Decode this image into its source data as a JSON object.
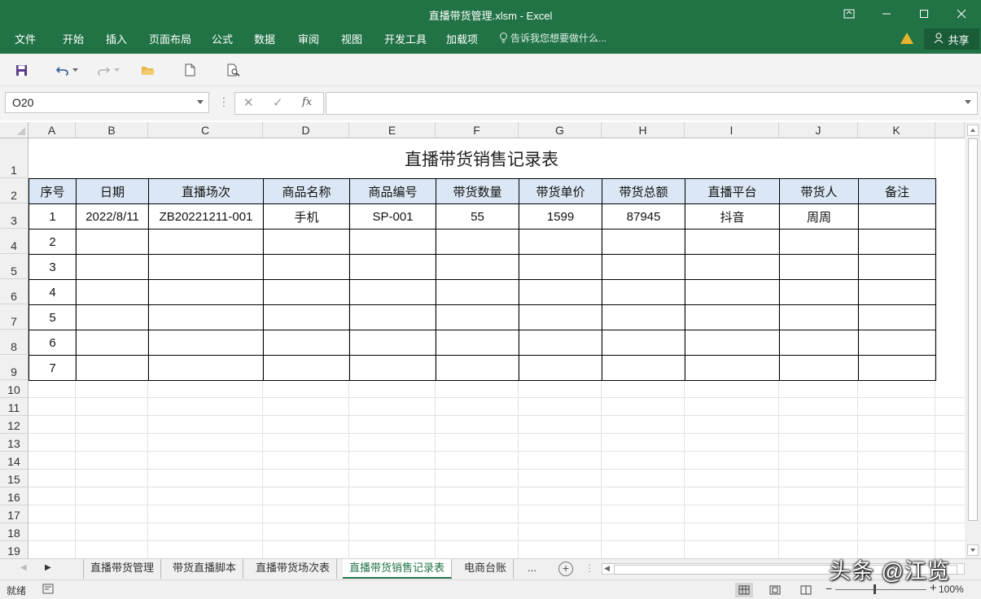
{
  "window": {
    "title": "直播带货管理.xlsm - Excel",
    "ribbon_tabs": [
      "文件",
      "开始",
      "插入",
      "页面布局",
      "公式",
      "数据",
      "审阅",
      "视图",
      "开发工具",
      "加载项"
    ],
    "tell_me": "告诉我您想要做什么...",
    "share": "共享"
  },
  "formula_bar": {
    "name_box": "O20",
    "fx": "fx",
    "content": ""
  },
  "grid": {
    "columns": [
      "A",
      "B",
      "C",
      "D",
      "E",
      "F",
      "G",
      "H",
      "I",
      "J",
      "K"
    ],
    "rows": [
      "1",
      "2",
      "3",
      "4",
      "5",
      "6",
      "7",
      "8",
      "9",
      "10",
      "11",
      "12",
      "13",
      "14",
      "15",
      "16",
      "17",
      "18",
      "19"
    ]
  },
  "sheet": {
    "title": "直播带货销售记录表",
    "headers": [
      "序号",
      "日期",
      "直播场次",
      "商品名称",
      "商品编号",
      "带货数量",
      "带货单价",
      "带货总额",
      "直播平台",
      "带货人",
      "备注"
    ],
    "rows": [
      [
        "1",
        "2022/8/11",
        "ZB20221211-001",
        "手机",
        "SP-001",
        "55",
        "1599",
        "87945",
        "抖音",
        "周周",
        ""
      ],
      [
        "2",
        "",
        "",
        "",
        "",
        "",
        "",
        "",
        "",
        "",
        ""
      ],
      [
        "3",
        "",
        "",
        "",
        "",
        "",
        "",
        "",
        "",
        "",
        ""
      ],
      [
        "4",
        "",
        "",
        "",
        "",
        "",
        "",
        "",
        "",
        "",
        ""
      ],
      [
        "5",
        "",
        "",
        "",
        "",
        "",
        "",
        "",
        "",
        "",
        ""
      ],
      [
        "6",
        "",
        "",
        "",
        "",
        "",
        "",
        "",
        "",
        "",
        ""
      ],
      [
        "7",
        "",
        "",
        "",
        "",
        "",
        "",
        "",
        "",
        "",
        ""
      ]
    ]
  },
  "sheet_tabs": {
    "items": [
      "直播带货管理",
      "带货直播脚本",
      "直播带货场次表",
      "直播带货销售记录表",
      "电商台账"
    ],
    "overflow": "...",
    "active": "直播带货销售记录表"
  },
  "status_bar": {
    "ready": "就绪",
    "zoom": "100%"
  },
  "watermark": "头条 @江览",
  "colors": {
    "excel_green": "#217346",
    "header_fill": "#dbe7f4"
  }
}
